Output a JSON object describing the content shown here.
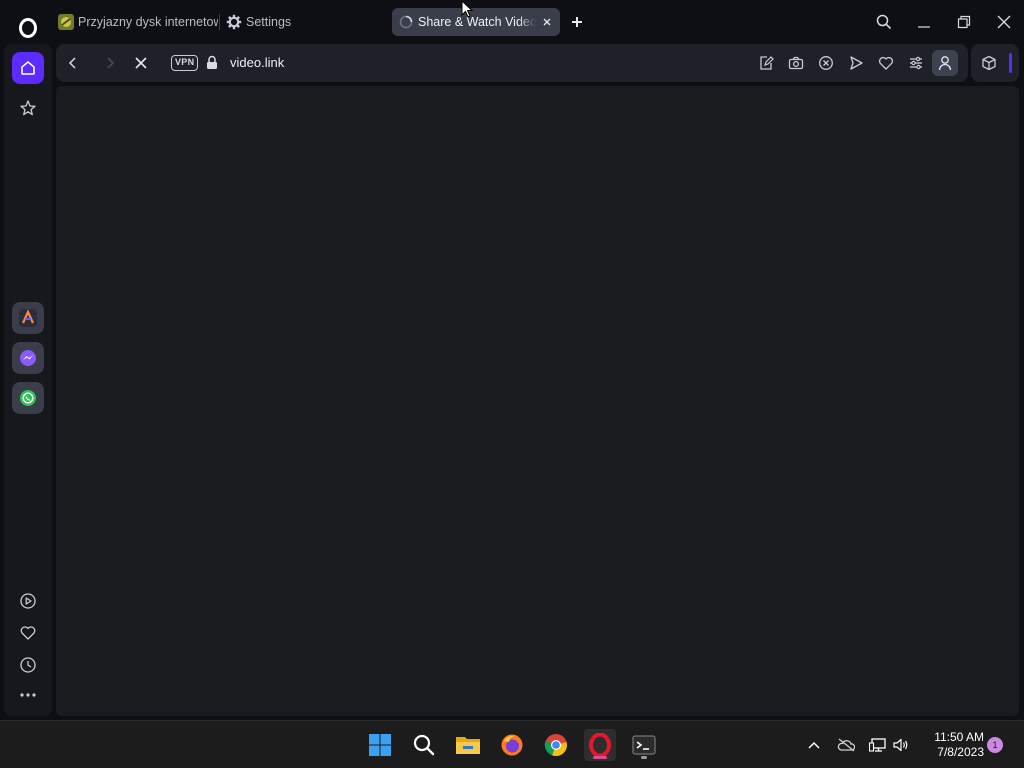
{
  "browser": {
    "tabs": [
      {
        "label": "Przyjazny dysk internetowy",
        "active": false
      },
      {
        "label": "Settings",
        "active": false
      },
      {
        "label": "Share & Watch Videos",
        "active": true,
        "loading": true
      }
    ],
    "window_controls": {
      "search": "search-icon",
      "minimize": "minimize-icon",
      "restore": "restore-icon",
      "close": "close-icon"
    }
  },
  "sidebar": {
    "top": [
      "opera-logo",
      "home-icon",
      "star-icon"
    ],
    "apps": [
      "aria-icon",
      "messenger-icon",
      "whatsapp-icon"
    ],
    "bottom": [
      "player-icon",
      "heart-icon",
      "history-icon",
      "more-icon"
    ]
  },
  "addressbar": {
    "vpn_label": "VPN",
    "url": "video.link",
    "tools": [
      "snapshot-edit-icon",
      "camera-icon",
      "ad-block-icon",
      "send-icon",
      "heart-icon",
      "easy-setup-icon",
      "profile-icon"
    ]
  },
  "taskbar": {
    "apps": [
      "windows-start-icon",
      "search-icon",
      "file-explorer-icon",
      "firefox-icon",
      "chrome-icon",
      "opera-icon",
      "terminal-icon"
    ],
    "time": "11:50 AM",
    "date": "7/8/2023",
    "notification_count": "1"
  },
  "colors": {
    "accent": "#5b2bff",
    "background": "#0e0f14",
    "content": "#1a1b1f"
  }
}
